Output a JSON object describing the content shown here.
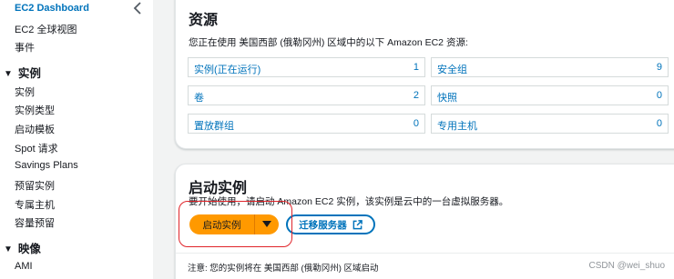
{
  "sidebar": {
    "dashboard": "EC2 Dashboard",
    "global_view": "EC2 全球视图",
    "events": "事件",
    "instances_section": "实例",
    "instances_items": [
      "实例",
      "实例类型",
      "启动模板",
      "Spot 请求",
      "Savings Plans",
      "预留实例",
      "专属主机",
      "容量预留"
    ],
    "images_section": "映像",
    "images_items": [
      "AMI"
    ]
  },
  "resources": {
    "title": "资源",
    "description": "您正在使用 美国西部 (俄勒冈州) 区域中的以下 Amazon EC2 资源:",
    "items": [
      {
        "label": "实例(正在运行)",
        "count": "1"
      },
      {
        "label": "安全组",
        "count": "9"
      },
      {
        "label": "卷",
        "count": "2"
      },
      {
        "label": "快照",
        "count": "0"
      },
      {
        "label": "置放群组",
        "count": "0"
      },
      {
        "label": "专用主机",
        "count": "0"
      }
    ]
  },
  "launch": {
    "title": "启动实例",
    "description": "要开始使用，请启动 Amazon EC2 实例，该实例是云中的一台虚拟服务器。",
    "launch_button": "启动实例",
    "migrate_button": "迁移服务器",
    "note": "注意: 您的实例将在 美国西部 (俄勒冈州) 区域启动"
  },
  "watermark": "CSDN @wei_shuo",
  "colors": {
    "accent": "#ff9900",
    "link": "#0073bb",
    "highlight": "#e0242a"
  }
}
